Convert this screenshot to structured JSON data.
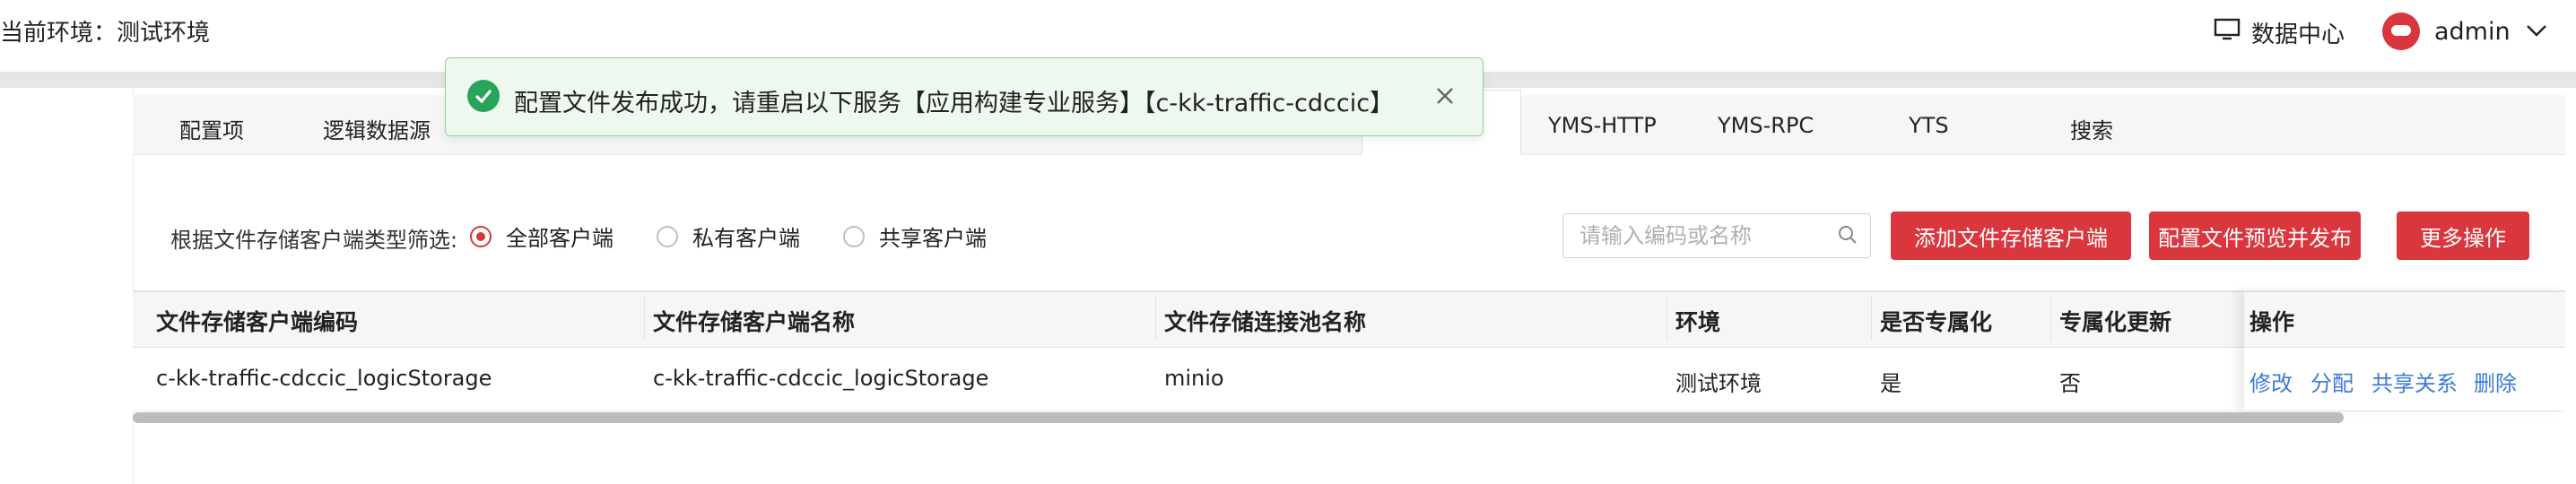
{
  "header": {
    "env_label": "当前环境：测试环境",
    "datacenter": "数据中心",
    "user": "admin"
  },
  "tabs": [
    {
      "label": "配置项"
    },
    {
      "label": "逻辑数据源"
    },
    {
      "label": "YMS-HTTP"
    },
    {
      "label": "YMS-RPC"
    },
    {
      "label": "YTS"
    },
    {
      "label": "搜索"
    }
  ],
  "toast": {
    "message": "配置文件发布成功，请重启以下服务【应用构建专业服务】【c-kk-traffic-cdccic】"
  },
  "filter": {
    "label": "根据文件存储客户端类型筛选:",
    "options": [
      "全部客户端",
      "私有客户端",
      "共享客户端"
    ],
    "selected": "全部客户端"
  },
  "search": {
    "placeholder": "请输入编码或名称",
    "value": ""
  },
  "actions": {
    "add": "添加文件存储客户端",
    "preview_publish": "配置文件预览并发布",
    "more": "更多操作"
  },
  "table": {
    "columns": [
      "文件存储客户端编码",
      "文件存储客户端名称",
      "文件存储连接池名称",
      "环境",
      "是否专属化",
      "专属化更新",
      "操作"
    ],
    "rows": [
      {
        "code": "c-kk-traffic-cdccic_logicStorage",
        "name": "c-kk-traffic-cdccic_logicStorage",
        "pool": "minio",
        "env": "测试环境",
        "exclusive": "是",
        "exclusive_update": "否",
        "ops": [
          "修改",
          "分配",
          "共享关系",
          "删除"
        ]
      }
    ]
  },
  "colors": {
    "primary": "#d9363e",
    "link": "#3d7ad8",
    "success": "#29a35a"
  }
}
